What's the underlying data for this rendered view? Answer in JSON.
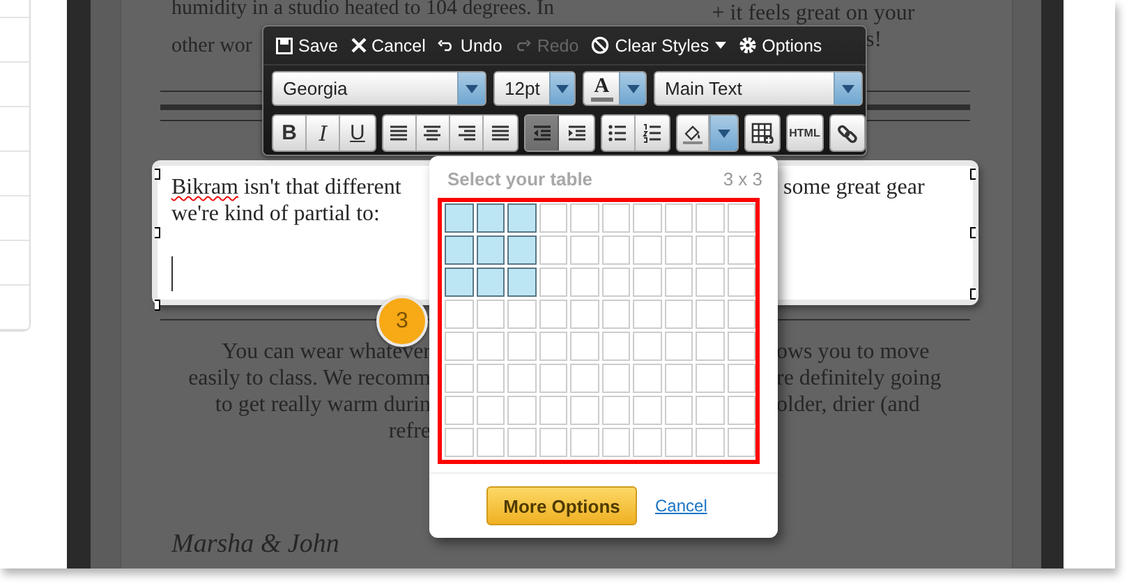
{
  "article": {
    "top_left_lines": [
      "humidity in a studio heated to 104 degrees. In",
      "other wor"
    ],
    "top_right_lines": [
      "+ it feels great on your",
      "s!"
    ],
    "editor": {
      "lines": [
        {
          "parts": [
            {
              "text": "Bikram",
              "misspelled": true
            },
            {
              "text": " isn't that different",
              "misspelled": false
            }
          ],
          "continuation": "some great gear"
        },
        {
          "parts": [
            {
              "text": "we're kind of partial to:",
              "misspelled": false
            }
          ]
        }
      ]
    },
    "body_lines": [
      {
        "left": "You can wear whatever",
        "right": "ows you to move"
      },
      {
        "left": "easily to class. We recomm",
        "right": "re definitely going"
      },
      {
        "left": "to get really warm durin",
        "right": "older, drier (and"
      },
      {
        "left": "refre"
      }
    ],
    "signature": "Marsha & John"
  },
  "toolbar": {
    "actions": [
      {
        "kind": "save",
        "label": "Save",
        "disabled": false,
        "dropdown": false
      },
      {
        "kind": "close",
        "label": "Cancel",
        "disabled": false,
        "dropdown": false
      },
      {
        "kind": "undo",
        "label": "Undo",
        "disabled": false,
        "dropdown": false
      },
      {
        "kind": "redo",
        "label": "Redo",
        "disabled": true,
        "dropdown": false
      },
      {
        "kind": "clear",
        "label": "Clear Styles",
        "disabled": false,
        "dropdown": true
      },
      {
        "kind": "gear",
        "label": "Options",
        "disabled": false,
        "dropdown": false
      }
    ],
    "font": "Georgia",
    "size": "12pt",
    "text_color": {
      "label": "A"
    },
    "paragraph_style": "Main Text",
    "format_groups": [
      [
        {
          "kind": "bold",
          "label": "B",
          "disabled": false
        },
        {
          "kind": "italic",
          "label": "I",
          "disabled": false
        },
        {
          "kind": "underline",
          "label": "U",
          "disabled": false
        }
      ],
      [
        {
          "kind": "align-left",
          "disabled": false
        },
        {
          "kind": "align-center",
          "disabled": false
        },
        {
          "kind": "align-right",
          "disabled": false
        },
        {
          "kind": "justify",
          "disabled": false
        }
      ],
      [
        {
          "kind": "outdent",
          "disabled": true
        },
        {
          "kind": "indent",
          "disabled": false
        }
      ],
      [
        {
          "kind": "bullets",
          "disabled": false
        },
        {
          "kind": "numbers",
          "disabled": false
        }
      ],
      [
        {
          "kind": "fill",
          "disabled": false
        }
      ],
      [
        {
          "kind": "table",
          "disabled": false
        }
      ],
      [
        {
          "kind": "html",
          "label": "HTML",
          "disabled": false
        }
      ],
      [
        {
          "kind": "link",
          "disabled": false
        }
      ]
    ]
  },
  "table_picker": {
    "title": "Select your table",
    "size": "3 x 3",
    "rows": [
      {
        "cells": [
          {
            "selected": true
          },
          {
            "selected": true
          },
          {
            "selected": true
          },
          {
            "selected": false
          },
          {
            "selected": false
          },
          {
            "selected": false
          },
          {
            "selected": false
          },
          {
            "selected": false
          },
          {
            "selected": false
          },
          {
            "selected": false
          }
        ]
      },
      {
        "cells": [
          {
            "selected": true
          },
          {
            "selected": true
          },
          {
            "selected": true
          },
          {
            "selected": false
          },
          {
            "selected": false
          },
          {
            "selected": false
          },
          {
            "selected": false
          },
          {
            "selected": false
          },
          {
            "selected": false
          },
          {
            "selected": false
          }
        ]
      },
      {
        "cells": [
          {
            "selected": true
          },
          {
            "selected": true
          },
          {
            "selected": true
          },
          {
            "selected": false
          },
          {
            "selected": false
          },
          {
            "selected": false
          },
          {
            "selected": false
          },
          {
            "selected": false
          },
          {
            "selected": false
          },
          {
            "selected": false
          }
        ]
      },
      {
        "cells": [
          {
            "selected": false
          },
          {
            "selected": false
          },
          {
            "selected": false
          },
          {
            "selected": false
          },
          {
            "selected": false
          },
          {
            "selected": false
          },
          {
            "selected": false
          },
          {
            "selected": false
          },
          {
            "selected": false
          },
          {
            "selected": false
          }
        ]
      },
      {
        "cells": [
          {
            "selected": false
          },
          {
            "selected": false
          },
          {
            "selected": false
          },
          {
            "selected": false
          },
          {
            "selected": false
          },
          {
            "selected": false
          },
          {
            "selected": false
          },
          {
            "selected": false
          },
          {
            "selected": false
          },
          {
            "selected": false
          }
        ]
      },
      {
        "cells": [
          {
            "selected": false
          },
          {
            "selected": false
          },
          {
            "selected": false
          },
          {
            "selected": false
          },
          {
            "selected": false
          },
          {
            "selected": false
          },
          {
            "selected": false
          },
          {
            "selected": false
          },
          {
            "selected": false
          },
          {
            "selected": false
          }
        ]
      },
      {
        "cells": [
          {
            "selected": false
          },
          {
            "selected": false
          },
          {
            "selected": false
          },
          {
            "selected": false
          },
          {
            "selected": false
          },
          {
            "selected": false
          },
          {
            "selected": false
          },
          {
            "selected": false
          },
          {
            "selected": false
          },
          {
            "selected": false
          }
        ]
      },
      {
        "cells": [
          {
            "selected": false
          },
          {
            "selected": false
          },
          {
            "selected": false
          },
          {
            "selected": false
          },
          {
            "selected": false
          },
          {
            "selected": false
          },
          {
            "selected": false
          },
          {
            "selected": false
          },
          {
            "selected": false
          },
          {
            "selected": false
          }
        ]
      }
    ],
    "more_options": "More Options",
    "cancel": "Cancel"
  },
  "step_badge": "3"
}
